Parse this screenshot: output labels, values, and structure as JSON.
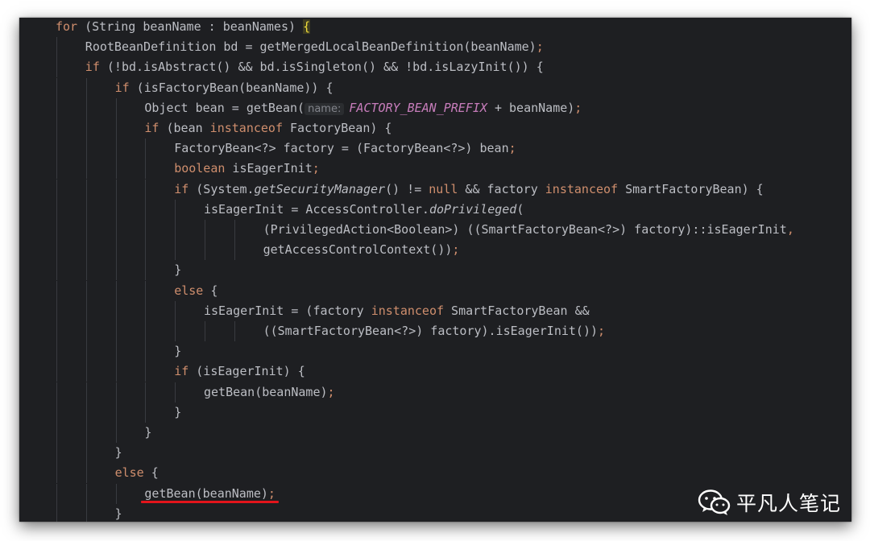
{
  "code_lines": [
    {
      "indent": 0,
      "tokens": [
        {
          "text": "for",
          "cls": "kw"
        },
        {
          "text": " (String beanName : beanNames) "
        },
        {
          "text": "{",
          "cls": "brace-hl"
        }
      ]
    },
    {
      "indent": 1,
      "tokens": [
        {
          "text": "RootBeanDefinition bd = getMergedLocalBeanDefinition(beanName)"
        },
        {
          "text": ";",
          "cls": "semi"
        }
      ]
    },
    {
      "indent": 1,
      "tokens": [
        {
          "text": "if",
          "cls": "kw"
        },
        {
          "text": " (!bd.isAbstract() && bd.isSingleton() && !bd.isLazyInit()) {"
        }
      ]
    },
    {
      "indent": 2,
      "tokens": [
        {
          "text": "if",
          "cls": "kw"
        },
        {
          "text": " (isFactoryBean(beanName)) {"
        }
      ]
    },
    {
      "indent": 3,
      "tokens": [
        {
          "text": "Object bean = getBean("
        },
        {
          "text": "name:",
          "cls": "hint"
        },
        {
          "text": "FACTORY_BEAN_PREFIX",
          "cls": "const"
        },
        {
          "text": " + beanName)"
        },
        {
          "text": ";",
          "cls": "semi"
        }
      ]
    },
    {
      "indent": 3,
      "tokens": [
        {
          "text": "if",
          "cls": "kw"
        },
        {
          "text": " (bean "
        },
        {
          "text": "instanceof",
          "cls": "kw"
        },
        {
          "text": " FactoryBean) {"
        }
      ]
    },
    {
      "indent": 4,
      "tokens": [
        {
          "text": "FactoryBean<?> factory = (FactoryBean<?>) bean"
        },
        {
          "text": ";",
          "cls": "semi"
        }
      ]
    },
    {
      "indent": 4,
      "tokens": [
        {
          "text": "boolean",
          "cls": "kw"
        },
        {
          "text": " isEagerInit"
        },
        {
          "text": ";",
          "cls": "semi"
        }
      ]
    },
    {
      "indent": 4,
      "tokens": [
        {
          "text": "if",
          "cls": "kw"
        },
        {
          "text": " (System."
        },
        {
          "text": "getSecurityManager",
          "cls": "italic"
        },
        {
          "text": "() != "
        },
        {
          "text": "null",
          "cls": "kw"
        },
        {
          "text": " && factory "
        },
        {
          "text": "instanceof",
          "cls": "kw"
        },
        {
          "text": " SmartFactoryBean) {"
        }
      ]
    },
    {
      "indent": 5,
      "tokens": [
        {
          "text": "isEagerInit = AccessController."
        },
        {
          "text": "doPrivileged",
          "cls": "italic"
        },
        {
          "text": "("
        }
      ]
    },
    {
      "indent": 7,
      "tokens": [
        {
          "text": "(PrivilegedAction<Boolean>) ((SmartFactoryBean<?>) factory)::isEagerInit"
        },
        {
          "text": ",",
          "cls": "semi"
        }
      ]
    },
    {
      "indent": 7,
      "tokens": [
        {
          "text": "getAccessControlContext())"
        },
        {
          "text": ";",
          "cls": "semi"
        }
      ]
    },
    {
      "indent": 4,
      "tokens": [
        {
          "text": "}"
        }
      ]
    },
    {
      "indent": 4,
      "tokens": [
        {
          "text": "else",
          "cls": "kw"
        },
        {
          "text": " {"
        }
      ]
    },
    {
      "indent": 5,
      "tokens": [
        {
          "text": "isEagerInit = (factory "
        },
        {
          "text": "instanceof",
          "cls": "kw"
        },
        {
          "text": " SmartFactoryBean &&"
        }
      ]
    },
    {
      "indent": 7,
      "tokens": [
        {
          "text": "((SmartFactoryBean<?>) factory).isEagerInit())"
        },
        {
          "text": ";",
          "cls": "semi"
        }
      ]
    },
    {
      "indent": 4,
      "tokens": [
        {
          "text": "}"
        }
      ]
    },
    {
      "indent": 4,
      "tokens": [
        {
          "text": "if",
          "cls": "kw"
        },
        {
          "text": " (isEagerInit) {"
        }
      ]
    },
    {
      "indent": 5,
      "tokens": [
        {
          "text": "getBean(beanName)"
        },
        {
          "text": ";",
          "cls": "semi"
        }
      ]
    },
    {
      "indent": 4,
      "tokens": [
        {
          "text": "}"
        }
      ]
    },
    {
      "indent": 3,
      "tokens": [
        {
          "text": "}"
        }
      ]
    },
    {
      "indent": 2,
      "tokens": [
        {
          "text": "}"
        }
      ]
    },
    {
      "indent": 2,
      "tokens": [
        {
          "text": "else",
          "cls": "kw"
        },
        {
          "text": " {"
        }
      ]
    },
    {
      "indent": 3,
      "tokens": [
        {
          "text": "getBean(beanName)"
        },
        {
          "text": ";",
          "cls": "semi"
        }
      ],
      "underlined": true
    },
    {
      "indent": 2,
      "tokens": [
        {
          "text": "}"
        }
      ]
    }
  ],
  "watermark": {
    "text": "平凡人笔记",
    "icon": "wechat-icon"
  },
  "colors": {
    "background": "#1e1f22",
    "keyword": "#cf8e6d",
    "default_text": "#bcbec4",
    "constant": "#c77dbb",
    "annotation_underline": "#e3141b",
    "brace_highlight": "#f0dd3a"
  }
}
